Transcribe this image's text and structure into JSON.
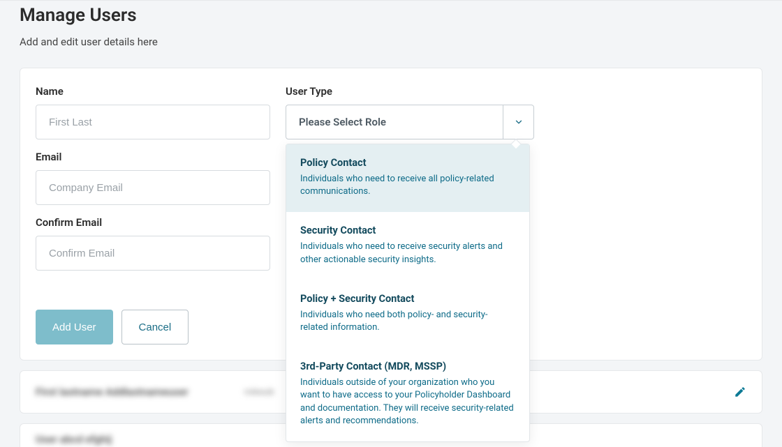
{
  "header": {
    "title": "Manage Users",
    "subtitle": "Add and edit user details here"
  },
  "form": {
    "name": {
      "label": "Name",
      "placeholder": "First Last"
    },
    "email": {
      "label": "Email",
      "placeholder": "Company Email"
    },
    "confirm": {
      "label": "Confirm Email",
      "placeholder": "Confirm Email"
    },
    "user_type": {
      "label": "User Type",
      "placeholder": "Please Select Role"
    },
    "add_btn": "Add User",
    "cancel_btn": "Cancel"
  },
  "dropdown": {
    "options": [
      {
        "title": "Policy Contact",
        "desc": "Individuals who need to receive all policy-related communications."
      },
      {
        "title": "Security Contact",
        "desc": "Individuals who need to receive security alerts and other actionable security insights."
      },
      {
        "title": "Policy + Security Contact",
        "desc": "Individuals who need both policy- and security-related information."
      },
      {
        "title": "3rd-Party Contact (MDR, MSSP)",
        "desc": "Individuals outside of your organization who you want to have access to your Policyholder Dashboard and documentation. They will receive security-related alerts and recommendations."
      }
    ]
  },
  "rows": {
    "r1_name": "First lastname Addlastnameuser",
    "r1_sub": "rolesub",
    "r2_name": "User abcd efghij"
  }
}
